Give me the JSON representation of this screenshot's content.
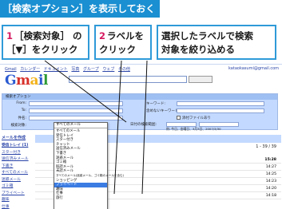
{
  "title": "［検索オプション］を表示しておく",
  "callouts": [
    {
      "num": "1",
      "line1": "［検索対象］ の",
      "line2": "［▼］をクリック"
    },
    {
      "num": "2",
      "line1": "ラベルを",
      "line2": "クリック"
    },
    {
      "num": "",
      "line1": "選択したラベルで検索",
      "line2": "対象を絞り込める"
    }
  ],
  "gmail": {
    "topbar": [
      "Gmail",
      "カレンダー",
      "ドキュメント",
      "写真",
      "グループ",
      "ウェブ",
      "その他"
    ],
    "account": "kataokasumi@gmail.com",
    "panel_title": "検索オプション",
    "fields": {
      "from": "From:",
      "to": "To:",
      "subject": "件名:",
      "search_target": "検索対象:",
      "keywords": "キーワード:",
      "exclude": "含めないキーワード:",
      "has_attachment": "添付ファイルあり",
      "date_range": "日付の検索範囲:",
      "date_hint": "例: 今日、金曜日、3月3日、2007/3/30"
    },
    "dropdown": {
      "selected": "すべてのメール",
      "items": [
        "すべてのメール",
        "受信トレイ",
        "スター付き",
        "チャット",
        "送信済みメール",
        "下書き",
        "迷惑メール",
        "ゴミ箱",
        "既読メール",
        "未読メール",
        "すべてのメール(迷惑メール、ゴミ箱のメールを含む)",
        "ショッピング",
        "プライベート",
        "趣味",
        "仕事",
        "旅行"
      ],
      "highlighted_index": 12
    },
    "sidebar": [
      "メールを作成",
      "受信トレイ (1)",
      "スター付き",
      "送信済みメール",
      "下書き",
      "すべてのメール",
      "迷惑メール",
      "ゴミ箱",
      "プライベート",
      "趣味",
      "仕事",
      "旅行"
    ],
    "pager": "1 - 39 / 39",
    "rows": [
      {
        "time": "15:28"
      },
      {
        "time": "14:27"
      },
      {
        "time": "14:25"
      },
      {
        "time": "14:23"
      },
      {
        "time": "14:20"
      },
      {
        "time": "14:18"
      }
    ]
  }
}
